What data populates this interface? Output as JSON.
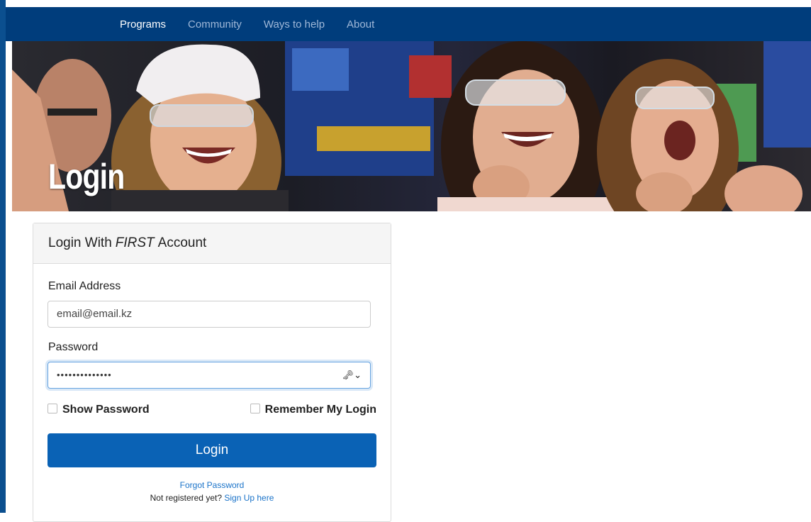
{
  "nav": {
    "items": [
      {
        "label": "Programs"
      },
      {
        "label": "Community"
      },
      {
        "label": "Ways to help"
      },
      {
        "label": "About"
      }
    ]
  },
  "hero": {
    "title": "Login"
  },
  "login": {
    "heading_prefix": "Login With",
    "heading_emphasis": "FIRST",
    "heading_suffix": "Account",
    "email_label": "Email Address",
    "email_value": "email@email.kz",
    "password_label": "Password",
    "password_masked": "••••••••••••••",
    "show_password_label": "Show Password",
    "remember_label": "Remember My Login",
    "submit_label": "Login",
    "forgot_link": "Forgot Password",
    "register_prompt": "Not registered yet?",
    "signup_link": "Sign Up here"
  },
  "colors": {
    "nav_bg": "#003d7c",
    "button_bg": "#0a62b5",
    "link": "#1a73c9"
  }
}
